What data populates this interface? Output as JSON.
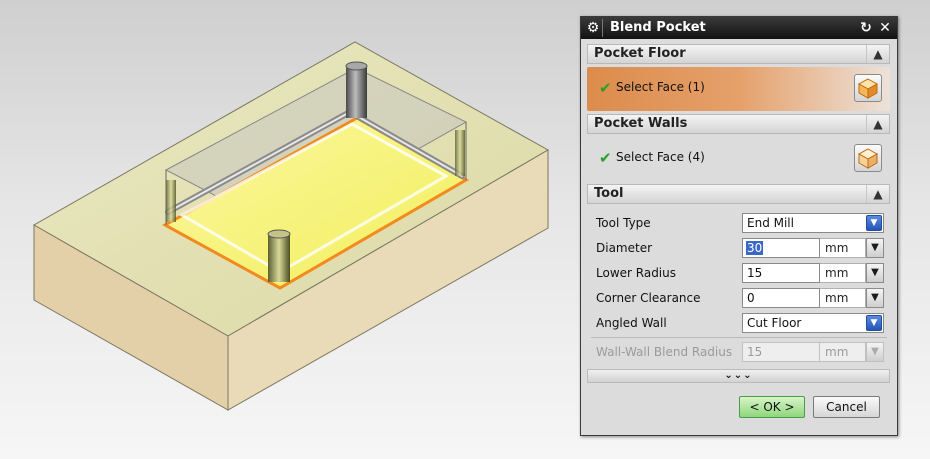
{
  "dialog": {
    "title": "Blend Pocket",
    "icons": {
      "settings": "gear-icon",
      "reset": "reset-icon",
      "close": "close-icon"
    },
    "close_glyph": "✕",
    "reset_glyph": "↻",
    "pocket_floor": {
      "header": "Pocket Floor",
      "select_label": "Select Face (1)",
      "status": "check-icon"
    },
    "pocket_walls": {
      "header": "Pocket Walls",
      "select_label": "Select Face (4)",
      "status": "check-icon"
    },
    "tool": {
      "header": "Tool",
      "rows": {
        "tool_type": {
          "label": "Tool Type",
          "value": "End Mill"
        },
        "diameter": {
          "label": "Diameter",
          "value": "30",
          "unit": "mm"
        },
        "lower_radius": {
          "label": "Lower Radius",
          "value": "15",
          "unit": "mm"
        },
        "corner_clearance": {
          "label": "Corner Clearance",
          "value": "0",
          "unit": "mm"
        },
        "angled_wall": {
          "label": "Angled Wall",
          "value": "Cut Floor"
        },
        "wall_blend_radius": {
          "label": "Wall-Wall Blend Radius",
          "value": "15",
          "unit": "mm",
          "enabled": false
        }
      }
    },
    "more_glyph": "⌄⌄⌄",
    "ok_label": "< OK >",
    "cancel_label": "Cancel"
  },
  "colors": {
    "selection_orange": "#dc8c4c",
    "floor_yellow": "#f6f37a",
    "block_top": "#e4e2b4",
    "block_side": "#e3cfa7",
    "ok_green": "#8ed77c",
    "combo_blue": "#2f62c6"
  }
}
